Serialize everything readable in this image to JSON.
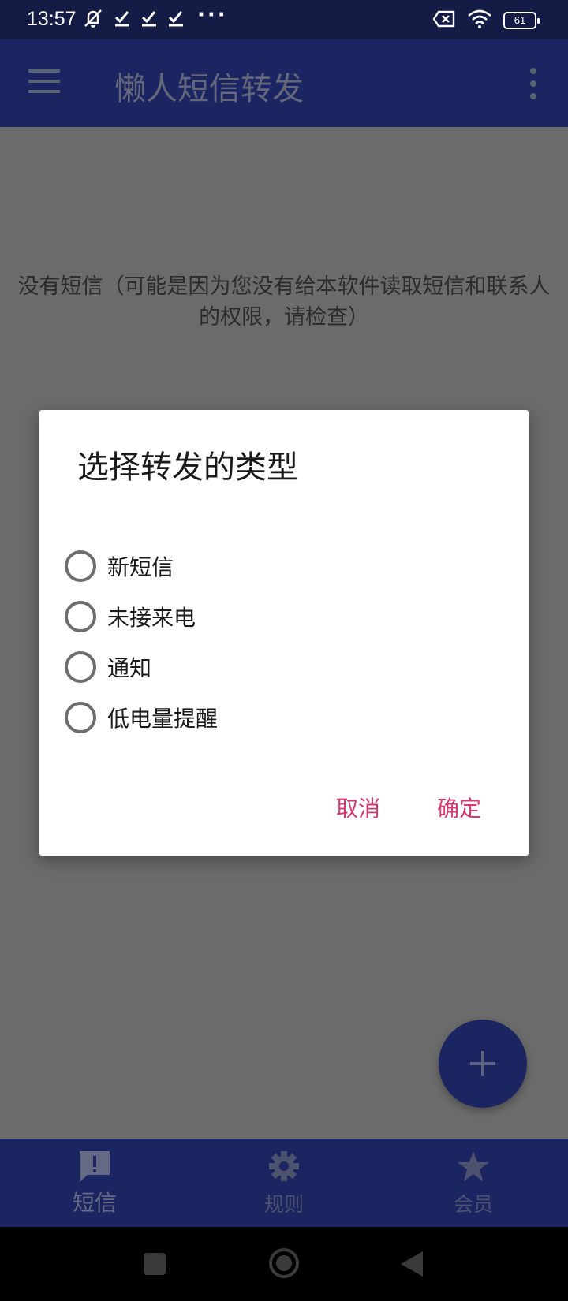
{
  "status_bar": {
    "time": "13:57",
    "dots": "···",
    "battery": "61",
    "icons": [
      "mute-icon",
      "check-icon",
      "check-icon",
      "check-icon",
      "sim-error-icon",
      "wifi-icon",
      "battery-icon"
    ]
  },
  "app_bar": {
    "title": "懒人短信转发",
    "icons": [
      "menu-icon",
      "more-options-icon"
    ]
  },
  "content": {
    "empty_message": "没有短信（可能是因为您没有给本软件读取短信和联系人的权限，请检查）"
  },
  "dialog": {
    "title": "选择转发的类型",
    "options": [
      {
        "label": "新短信",
        "selected": false
      },
      {
        "label": "未接来电",
        "selected": false
      },
      {
        "label": "通知",
        "selected": false
      },
      {
        "label": "低电量提醒",
        "selected": false
      }
    ],
    "cancel_label": "取消",
    "confirm_label": "确定",
    "accent_color": "#d6386f"
  },
  "fab": {
    "icon": "plus-icon"
  },
  "bottom_nav": {
    "items": [
      {
        "label": "短信",
        "icon": "message-alert-icon",
        "active": true
      },
      {
        "label": "规则",
        "icon": "gear-icon",
        "active": false
      },
      {
        "label": "会员",
        "icon": "star-icon",
        "active": false
      }
    ]
  },
  "colors": {
    "primary": "#1b2562",
    "status_bar": "#141b45",
    "scrim_background": "#6b6b6b"
  }
}
